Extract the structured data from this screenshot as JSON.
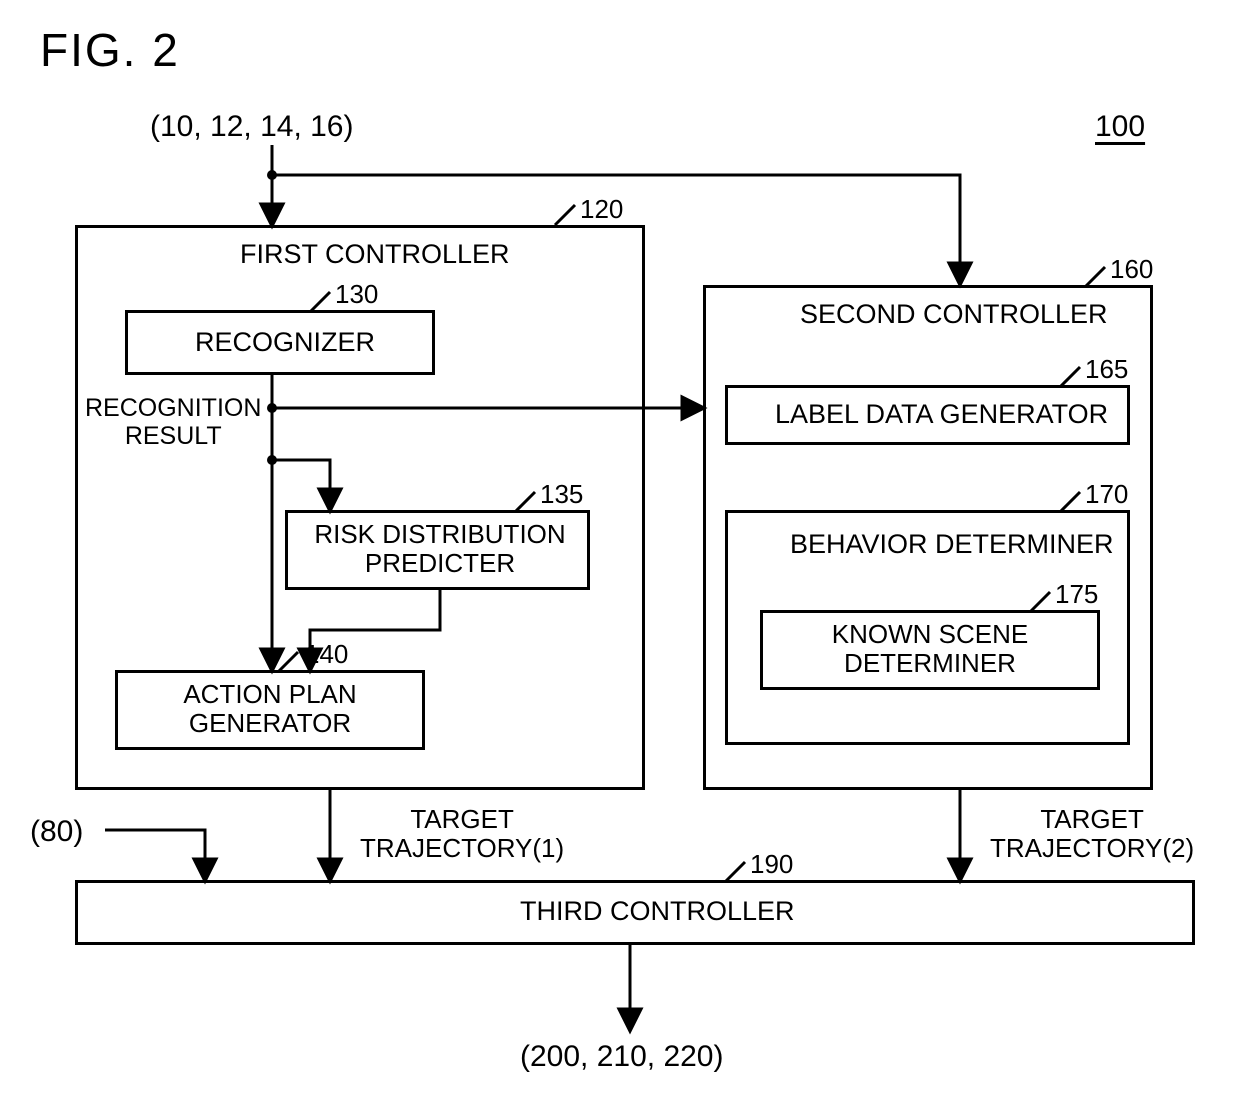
{
  "figure_label": "FIG. 2",
  "inputs_top": "(10, 12, 14, 16)",
  "ref_100": "100",
  "first_controller": {
    "title": "FIRST CONTROLLER",
    "ref": "120",
    "recognizer": {
      "label": "RECOGNIZER",
      "ref": "130"
    },
    "recognition_result": "RECOGNITION\nRESULT",
    "risk_predicter": {
      "label": "RISK DISTRIBUTION\nPREDICTER",
      "ref": "135"
    },
    "action_plan": {
      "label": "ACTION PLAN\nGENERATOR",
      "ref": "140"
    }
  },
  "second_controller": {
    "title": "SECOND CONTROLLER",
    "ref": "160",
    "label_data_gen": {
      "label": "LABEL DATA GENERATOR",
      "ref": "165"
    },
    "behavior_determiner": {
      "label": "BEHAVIOR DETERMINER",
      "ref": "170"
    },
    "known_scene": {
      "label": "KNOWN SCENE\nDETERMINER",
      "ref": "175"
    }
  },
  "input_80": "(80)",
  "target_traj_1": "TARGET\nTRAJECTORY(1)",
  "target_traj_2": "TARGET\nTRAJECTORY(2)",
  "third_controller": {
    "label": "THIRD CONTROLLER",
    "ref": "190"
  },
  "outputs_bottom": "(200, 210, 220)"
}
